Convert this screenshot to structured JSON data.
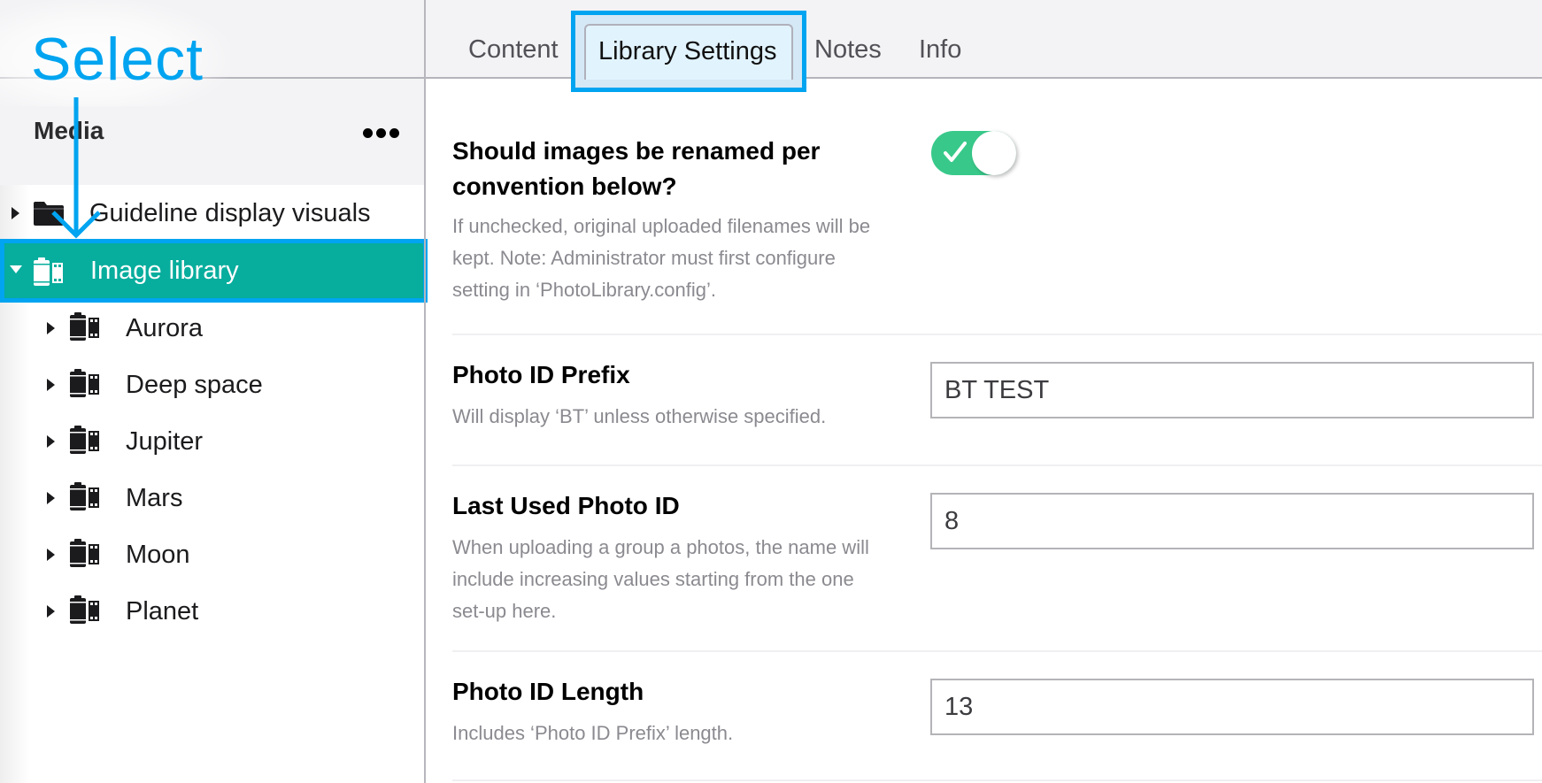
{
  "annotation": {
    "label": "Select",
    "color": "#00a4f0"
  },
  "sidebar": {
    "title": "Media",
    "more_icon": "more-horizontal-icon",
    "tree": [
      {
        "label": "Guideline display visuals",
        "icon": "folder-icon",
        "expanded": false,
        "selected": false,
        "level": 0
      },
      {
        "label": "Image library",
        "icon": "film-roll-icon",
        "expanded": true,
        "selected": true,
        "level": 0
      },
      {
        "label": "Aurora",
        "icon": "film-roll-icon",
        "expanded": false,
        "selected": false,
        "level": 1
      },
      {
        "label": "Deep space",
        "icon": "film-roll-icon",
        "expanded": false,
        "selected": false,
        "level": 1
      },
      {
        "label": "Jupiter",
        "icon": "film-roll-icon",
        "expanded": false,
        "selected": false,
        "level": 1
      },
      {
        "label": "Mars",
        "icon": "film-roll-icon",
        "expanded": false,
        "selected": false,
        "level": 1
      },
      {
        "label": "Moon",
        "icon": "film-roll-icon",
        "expanded": false,
        "selected": false,
        "level": 1
      },
      {
        "label": "Planet",
        "icon": "film-roll-icon",
        "expanded": false,
        "selected": false,
        "level": 1
      }
    ],
    "selected_color": "#07ad9d"
  },
  "tabs": [
    {
      "label": "Content",
      "active": false
    },
    {
      "label": "Library Settings",
      "active": true
    },
    {
      "label": "Notes",
      "active": false
    },
    {
      "label": "Info",
      "active": false
    }
  ],
  "settings": {
    "rename": {
      "title_line1": "Should images be renamed per",
      "title_line2": "convention below?",
      "desc_line1": "If unchecked, original uploaded filenames will be",
      "desc_line2": "kept. Note: Administrator must first configure",
      "desc_line3": "setting in ‘PhotoLibrary.config’.",
      "enabled": true,
      "toggle_color": "#38c98a"
    },
    "prefix": {
      "title": "Photo ID Prefix",
      "desc": "Will display ‘BT’ unless otherwise specified.",
      "value": "BT TEST"
    },
    "last_used": {
      "title": "Last Used Photo ID",
      "desc_line1": "When uploading a group a photos, the name will",
      "desc_line2": "include increasing values starting from the one",
      "desc_line3": "set-up here.",
      "value": "8"
    },
    "length": {
      "title": "Photo ID Length",
      "desc": "Includes ‘Photo ID Prefix’ length.",
      "value": "13"
    }
  }
}
